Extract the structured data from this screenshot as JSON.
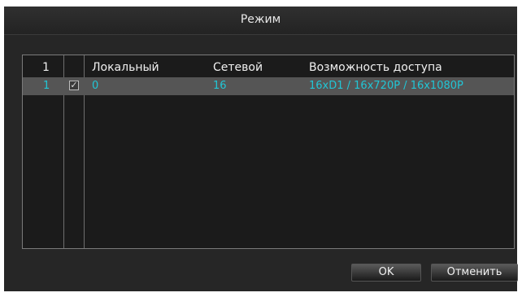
{
  "dialog": {
    "title": "Режим"
  },
  "table": {
    "columns": [
      "1",
      "Локальный",
      "Сетевой",
      "Возможность доступа"
    ],
    "rows": [
      {
        "index": "1",
        "checked": true,
        "local": "0",
        "network": "16",
        "access": "16xD1 / 16x720P / 16x1080P"
      }
    ]
  },
  "buttons": {
    "ok": "OK",
    "cancel": "Отменить"
  },
  "colors": {
    "background": "#262626",
    "selected_row": "#555555",
    "accent_text": "#21c6d6"
  }
}
